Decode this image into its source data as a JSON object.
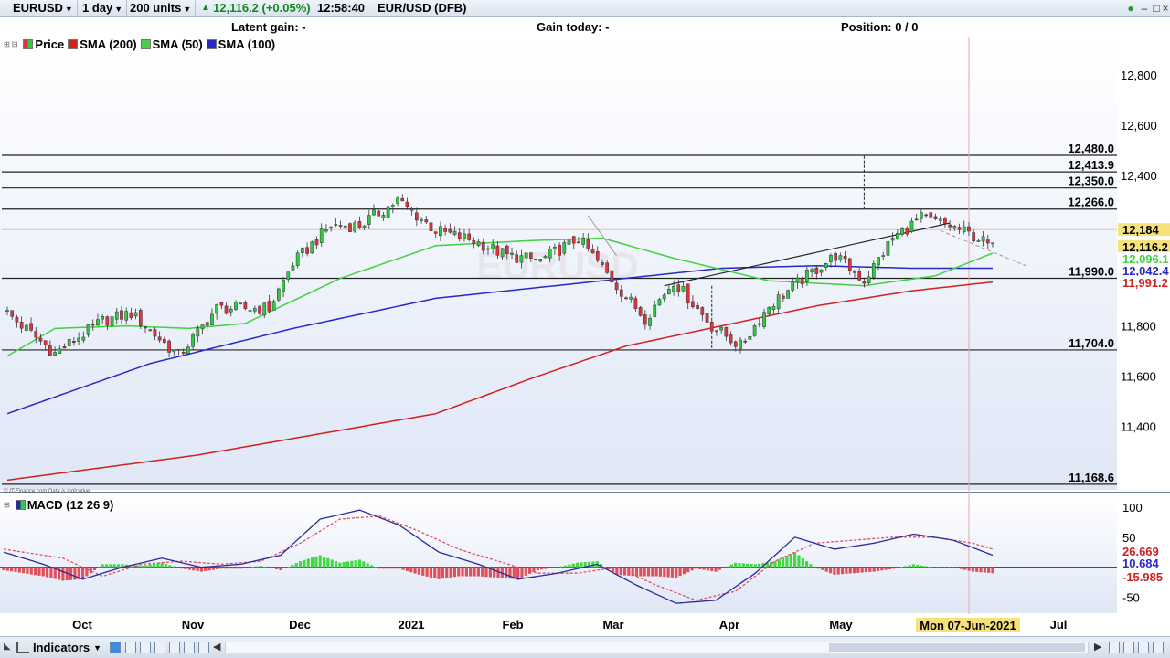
{
  "toolbar": {
    "symbol_dd": "EURUSD",
    "interval_dd": "1 day",
    "size_dd": "200 units",
    "quote": "12,116.2 (+0.05%)",
    "time": "12:58:40",
    "symbol": "EUR/USD (DFB)"
  },
  "info": {
    "latent_gain": "Latent gain: -",
    "gain_today": "Gain today: -",
    "position": "Position: 0   / 0"
  },
  "legend": {
    "price": "Price",
    "sma200": "SMA (200)",
    "sma50": "SMA (50)",
    "sma100": "SMA (100)",
    "macd": "MACD (12 26 9)",
    "disclaimer": "© IT-Finance.com  Data is indicative",
    "watermark": "EURUSD"
  },
  "colors": {
    "up": "#2ecc40",
    "down": "#e0333c",
    "sma200": "#d02020",
    "sma50": "#43d043",
    "sma100": "#2828c8",
    "macd_line": "#2a2a9a",
    "signal_line": "#e05060",
    "bg_top": "#ffffff",
    "bg_bottom": "#dfe7f6"
  },
  "bottom": {
    "indicators": "Indicators"
  },
  "chart_data": [
    {
      "type": "candlestick",
      "ylim": [
        11150,
        12950
      ],
      "y_ticks": [
        "12,800",
        "12,600",
        "12,400",
        "11,800",
        "11,600",
        "11,400"
      ],
      "x_labels": [
        "Oct",
        "Nov",
        "Dec",
        "2021",
        "Feb",
        "Mar",
        "Apr",
        "May",
        "Jul"
      ],
      "cursor_label": "Mon 07-Jun-2021",
      "horizontal_levels": [
        {
          "value": 12480,
          "label": "12,480.0"
        },
        {
          "value": 12413.9,
          "label": "12,413.9"
        },
        {
          "value": 12350,
          "label": "12,350.0"
        },
        {
          "value": 12266,
          "label": "12,266.0"
        },
        {
          "value": 11990,
          "label": "11,990.0"
        },
        {
          "value": 11704,
          "label": "11,704.0"
        },
        {
          "value": 11168.6,
          "label": "11,168.6"
        }
      ],
      "price_badges": [
        {
          "value": 12184,
          "label": "12,184",
          "color": "#f2c200"
        },
        {
          "value": 12116.2,
          "label": "12,116.2",
          "color": "#f2c200"
        },
        {
          "value": 12096,
          "label": "12,096.1",
          "color": "#43d043"
        },
        {
          "value": 12042.4,
          "label": "12,042.4",
          "color": "#2828c8"
        },
        {
          "value": 11991.2,
          "label": "11,991.2",
          "color": "#d02020"
        }
      ],
      "close_anchors": [
        [
          0,
          11850
        ],
        [
          10,
          11690
        ],
        [
          20,
          11820
        ],
        [
          26,
          11850
        ],
        [
          36,
          11680
        ],
        [
          44,
          11870
        ],
        [
          55,
          11870
        ],
        [
          60,
          12050
        ],
        [
          68,
          12200
        ],
        [
          74,
          12200
        ],
        [
          82,
          12300
        ],
        [
          90,
          12180
        ],
        [
          98,
          12140
        ],
        [
          105,
          12080
        ],
        [
          112,
          12060
        ],
        [
          120,
          12150
        ],
        [
          128,
          11960
        ],
        [
          134,
          11830
        ],
        [
          140,
          11980
        ],
        [
          148,
          11800
        ],
        [
          154,
          11720
        ],
        [
          160,
          11880
        ],
        [
          168,
          12000
        ],
        [
          174,
          12080
        ],
        [
          180,
          11980
        ],
        [
          186,
          12150
        ],
        [
          192,
          12230
        ],
        [
          198,
          12200
        ],
        [
          204,
          12150
        ],
        [
          207,
          12110
        ]
      ],
      "sma200_anchors": [
        [
          0,
          11185
        ],
        [
          40,
          11285
        ],
        [
          90,
          11450
        ],
        [
          110,
          11590
        ],
        [
          130,
          11720
        ],
        [
          150,
          11800
        ],
        [
          170,
          11880
        ],
        [
          190,
          11940
        ],
        [
          207,
          11975
        ]
      ],
      "sma100_anchors": [
        [
          0,
          11450
        ],
        [
          30,
          11650
        ],
        [
          60,
          11790
        ],
        [
          90,
          11910
        ],
        [
          110,
          11950
        ],
        [
          130,
          11990
        ],
        [
          150,
          12030
        ],
        [
          170,
          12040
        ],
        [
          190,
          12030
        ],
        [
          207,
          12030
        ]
      ],
      "sma50_anchors": [
        [
          0,
          11680
        ],
        [
          10,
          11790
        ],
        [
          25,
          11800
        ],
        [
          38,
          11790
        ],
        [
          50,
          11810
        ],
        [
          70,
          11990
        ],
        [
          90,
          12120
        ],
        [
          110,
          12140
        ],
        [
          125,
          12150
        ],
        [
          140,
          12070
        ],
        [
          160,
          11980
        ],
        [
          180,
          11960
        ],
        [
          195,
          12000
        ],
        [
          207,
          12090
        ]
      ]
    },
    {
      "type": "macd",
      "ylim": [
        -75,
        115
      ],
      "y_ticks": [
        "100",
        "50",
        "-50"
      ],
      "badges": [
        {
          "value": 26.669,
          "label": "26.669",
          "color": "#d02020"
        },
        {
          "value": 10.684,
          "label": "10.684",
          "color": "#2828c8"
        },
        {
          "value": -15.985,
          "label": "-15.985",
          "color": "#d02020"
        }
      ],
      "macd_anchors": [
        [
          0,
          25
        ],
        [
          10,
          5
        ],
        [
          20,
          -20
        ],
        [
          30,
          0
        ],
        [
          40,
          15
        ],
        [
          50,
          0
        ],
        [
          60,
          5
        ],
        [
          70,
          20
        ],
        [
          80,
          80
        ],
        [
          90,
          95
        ],
        [
          100,
          70
        ],
        [
          110,
          25
        ],
        [
          120,
          5
        ],
        [
          130,
          -20
        ],
        [
          140,
          -10
        ],
        [
          150,
          5
        ],
        [
          160,
          -30
        ],
        [
          170,
          -60
        ],
        [
          180,
          -55
        ],
        [
          190,
          -10
        ],
        [
          200,
          50
        ],
        [
          210,
          30
        ],
        [
          220,
          40
        ],
        [
          230,
          55
        ],
        [
          240,
          45
        ],
        [
          250,
          20
        ]
      ],
      "signal_anchors": [
        [
          0,
          30
        ],
        [
          15,
          15
        ],
        [
          25,
          -15
        ],
        [
          35,
          5
        ],
        [
          45,
          10
        ],
        [
          55,
          5
        ],
        [
          65,
          10
        ],
        [
          75,
          40
        ],
        [
          85,
          80
        ],
        [
          95,
          85
        ],
        [
          105,
          60
        ],
        [
          115,
          30
        ],
        [
          125,
          10
        ],
        [
          135,
          -10
        ],
        [
          145,
          -10
        ],
        [
          155,
          0
        ],
        [
          165,
          -30
        ],
        [
          175,
          -55
        ],
        [
          185,
          -40
        ],
        [
          195,
          10
        ],
        [
          205,
          40
        ],
        [
          215,
          45
        ],
        [
          225,
          50
        ],
        [
          235,
          50
        ],
        [
          245,
          40
        ],
        [
          250,
          30
        ]
      ]
    }
  ]
}
